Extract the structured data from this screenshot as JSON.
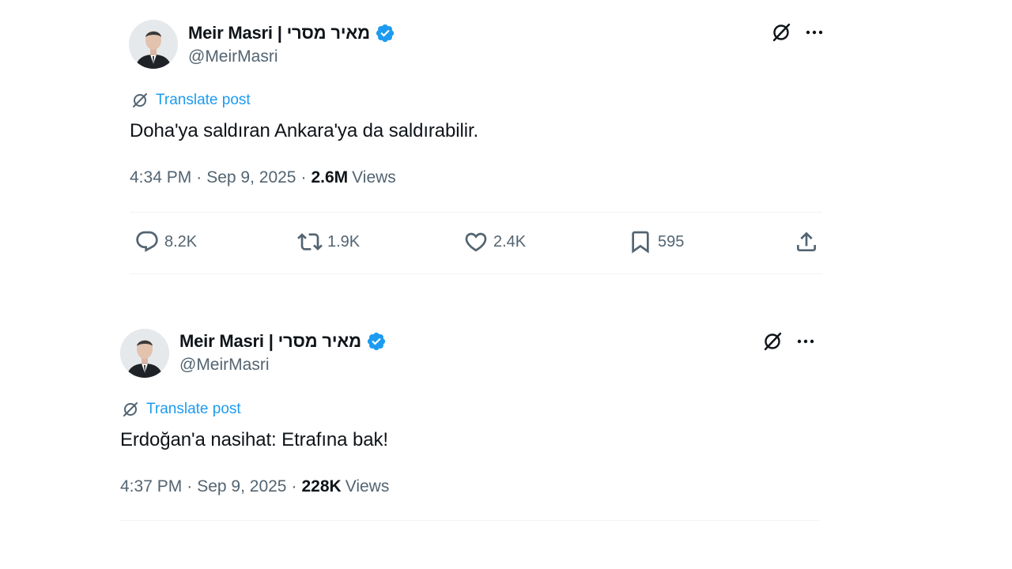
{
  "colors": {
    "text_primary": "#0f1419",
    "text_secondary": "#536471",
    "link_blue": "#1d9bf0",
    "verified_blue": "#1d9bf0",
    "divider": "#eff3f4"
  },
  "tweets": [
    {
      "author": {
        "display_name": "Meir Masri | מאיר מסרי",
        "handle": "@MeirMasri",
        "verified_icon": "verified-badge-icon",
        "avatar": "profile-photo"
      },
      "top_actions": {
        "grok_icon": "grok-icon",
        "more_icon": "more-horizontal-icon"
      },
      "translate_label": "Translate post",
      "text": "Doha'ya saldıran Ankara'ya da saldırabilir.",
      "time": "4:34 PM",
      "separator": "·",
      "date": "Sep 9, 2025",
      "views_count": "2.6M",
      "views_label": "Views",
      "actions": {
        "replies": "8.2K",
        "reposts": "1.9K",
        "likes": "2.4K",
        "bookmarks": "595"
      }
    },
    {
      "author": {
        "display_name": "Meir Masri | מאיר מסרי",
        "handle": "@MeirMasri",
        "verified_icon": "verified-badge-icon",
        "avatar": "profile-photo"
      },
      "top_actions": {
        "grok_icon": "grok-icon",
        "more_icon": "more-horizontal-icon"
      },
      "translate_label": "Translate post",
      "text": "Erdoğan'a nasihat: Etrafına bak!",
      "time": "4:37 PM",
      "separator": "·",
      "date": "Sep 9, 2025",
      "views_count": "228K",
      "views_label": "Views"
    }
  ]
}
